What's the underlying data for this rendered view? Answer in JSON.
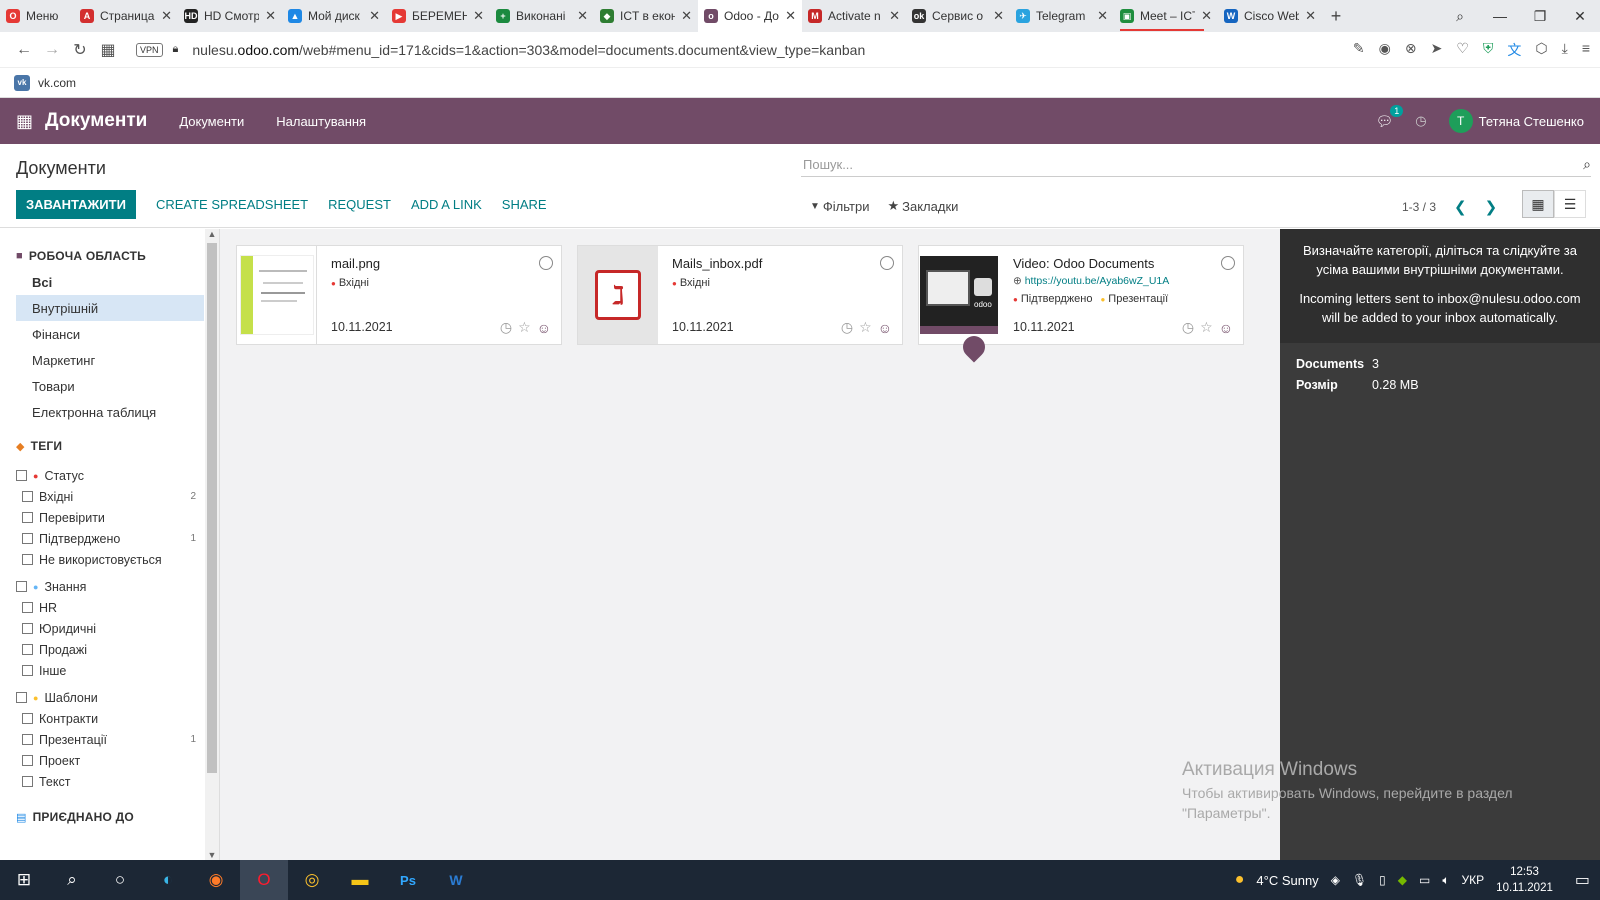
{
  "browser": {
    "tabs": [
      {
        "label": "Меню",
        "color": "#e53935",
        "glyph": "O"
      },
      {
        "label": "Страница",
        "color": "#d32f2f",
        "glyph": "A"
      },
      {
        "label": "HD Смотреть",
        "color": "#222222",
        "glyph": "HD"
      },
      {
        "label": "Мой диск",
        "color": "#1e88e5",
        "glyph": "▲"
      },
      {
        "label": "БЕРЕМЕНН",
        "color": "#e53935",
        "glyph": "▶"
      },
      {
        "label": "Виконані",
        "color": "#1b8a3f",
        "glyph": "+"
      },
      {
        "label": "ICT в екон",
        "color": "#2e7d32",
        "glyph": "◆"
      },
      {
        "label": "Odoo - До",
        "color": "#714b67",
        "glyph": "o"
      },
      {
        "label": "Activate n",
        "color": "#c62828",
        "glyph": "M"
      },
      {
        "label": "Сервис о",
        "color": "#333333",
        "glyph": "ok"
      },
      {
        "label": "Telegram",
        "color": "#2aa3df",
        "glyph": "✈"
      },
      {
        "label": "Meet – ICT",
        "color": "#1e8e3e",
        "glyph": "▣"
      },
      {
        "label": "Cisco Web",
        "color": "#1565c0",
        "glyph": "W"
      }
    ],
    "url_prefix": "nulesu.",
    "url_domain": "odoo.com",
    "url_path": "/web#menu_id=171&cids=1&action=303&model=documents.document&view_type=kanban",
    "vpn_label": "VPN",
    "bookmark": "vk.com",
    "bookmark_glyph": "vk"
  },
  "nav": {
    "brand": "Документи",
    "menus": [
      "Документи",
      "Налаштування"
    ],
    "chat_count": "1",
    "avatar_letter": "T",
    "user": "Тетяна Стешенко"
  },
  "control": {
    "title": "Документи",
    "search_placeholder": "Пошук...",
    "upload": "ЗАВАНТАЖИТИ",
    "spreadsheet": "CREATE SPREADSHEET",
    "request": "REQUEST",
    "add_link": "ADD A LINK",
    "share": "SHARE",
    "filters": "Фільтри",
    "bookmarks": "Закладки",
    "pager": "1-3 / 3"
  },
  "sidebar": {
    "workspace_title": "РОБОЧА ОБЛАСТЬ",
    "workspaces": [
      "Всі",
      "Внутрішній",
      "Фінанси",
      "Маркетинг",
      "Товари",
      "Електронна таблиця"
    ],
    "tags_title": "ТЕГИ",
    "groups": [
      {
        "name": "Статус",
        "color": "#e53935",
        "items": [
          {
            "label": "Вхідні",
            "count": "2"
          },
          {
            "label": "Перевірити",
            "count": ""
          },
          {
            "label": "Підтверджено",
            "count": "1"
          },
          {
            "label": "Не використовується",
            "count": ""
          }
        ]
      },
      {
        "name": "Знання",
        "color": "#64b5f6",
        "items": [
          {
            "label": "HR",
            "count": ""
          },
          {
            "label": "Юридичні",
            "count": ""
          },
          {
            "label": "Продажі",
            "count": ""
          },
          {
            "label": "Інше",
            "count": ""
          }
        ]
      },
      {
        "name": "Шаблони",
        "color": "#fbc02d",
        "items": [
          {
            "label": "Контракти",
            "count": ""
          },
          {
            "label": "Презентації",
            "count": "1"
          },
          {
            "label": "Проект",
            "count": ""
          },
          {
            "label": "Текст",
            "count": ""
          }
        ]
      }
    ],
    "attached_title": "ПРИЄДНАНО ДО"
  },
  "cards": [
    {
      "name": "mail.png",
      "tags": [
        "Вхідні"
      ],
      "url": "",
      "date": "10.11.2021"
    },
    {
      "name": "Mails_inbox.pdf",
      "tags": [
        "Вхідні"
      ],
      "url": "",
      "date": "10.11.2021"
    },
    {
      "name": "Video: Odoo Documents",
      "tags": [
        "Підтверджено",
        "Презентації"
      ],
      "url": "https://youtu.be/Ayab6wZ_U1A",
      "date": "10.11.2021"
    }
  ],
  "video_thumb_label": "odoo",
  "info": {
    "line1": "Визначайте категорії, діліться та слідкуйте за усіма вашими внутрішніми документами.",
    "line2": "Incoming letters sent to inbox@nulesu.odoo.com will be added to your inbox automatically.",
    "docs_label": "Documents",
    "docs_value": "3",
    "size_label": "Розмір",
    "size_value": "0.28 MB"
  },
  "watermark": {
    "title": "Активация Windows",
    "line1": "Чтобы активировать Windows, перейдите в раздел",
    "line2": "\"Параметры\"."
  },
  "taskbar": {
    "weather": "4°C  Sunny",
    "lang": "УКР",
    "time": "12:53",
    "date": "10.11.2021"
  }
}
